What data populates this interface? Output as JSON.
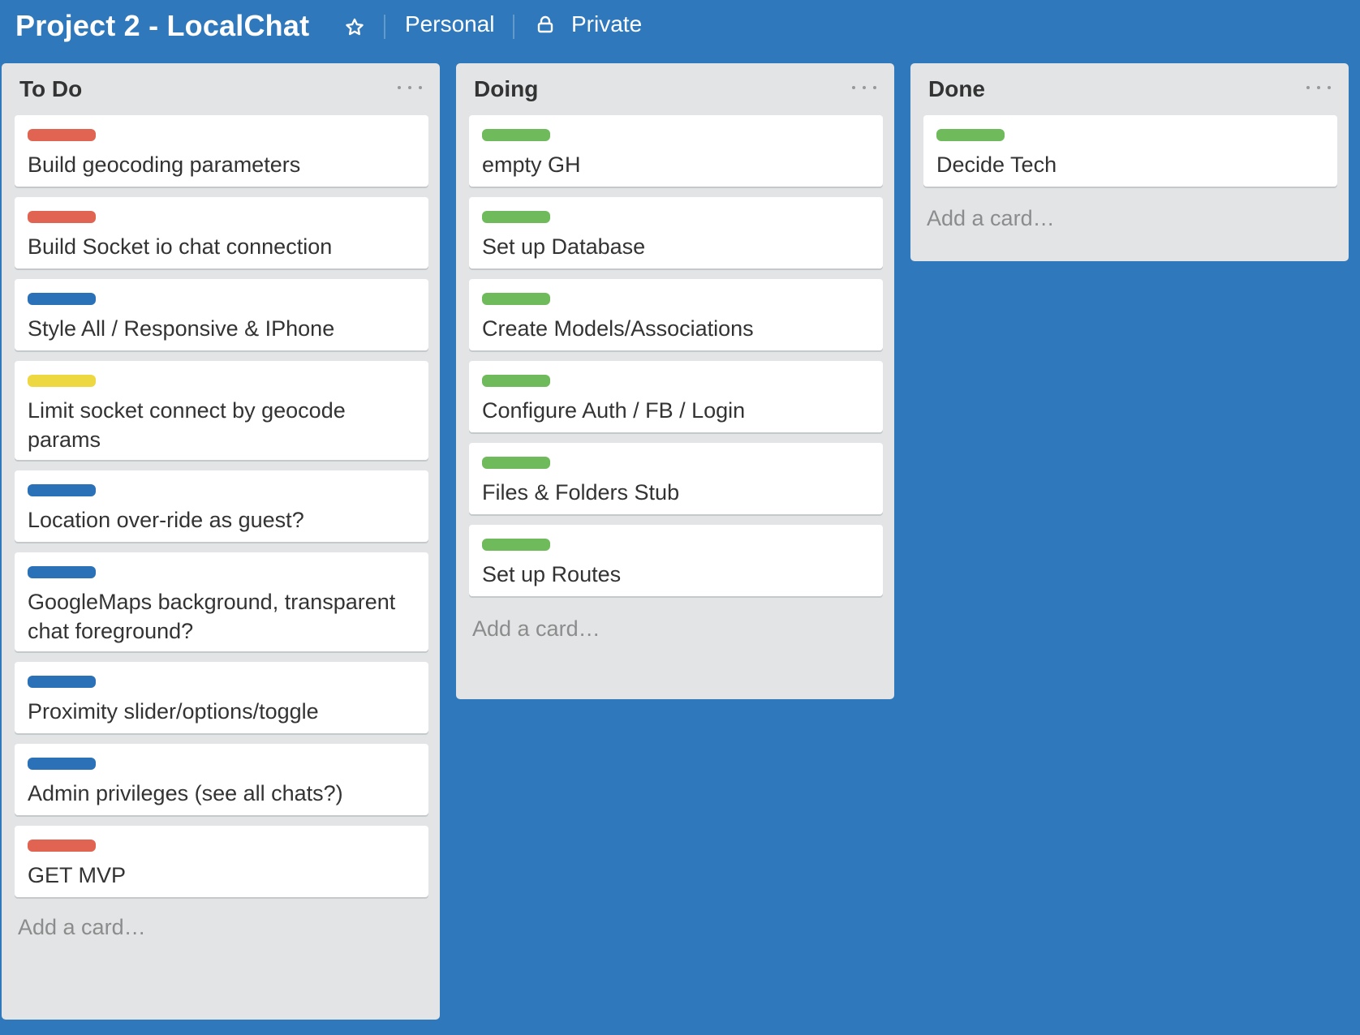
{
  "header": {
    "board_title": "Project 2 - LocalChat",
    "team": "Personal",
    "visibility": "Private",
    "star_icon": "star-icon",
    "lock_icon": "lock-icon"
  },
  "colors": {
    "background": "#2f78bb",
    "list_background": "#e2e4e6",
    "label_red": "#e06451",
    "label_blue": "#2a71b8",
    "label_yellow": "#eed842",
    "label_green": "#6fba5a"
  },
  "lists": [
    {
      "title": "To Do",
      "add_card": "Add a card…",
      "cards": [
        {
          "label": "red",
          "title": "Build geocoding parameters"
        },
        {
          "label": "red",
          "title": "Build Socket io chat connection"
        },
        {
          "label": "blue",
          "title": "Style All / Responsive & IPhone"
        },
        {
          "label": "yellow",
          "title": "Limit socket connect by geocode params"
        },
        {
          "label": "blue",
          "title": "Location over-ride as guest?"
        },
        {
          "label": "blue",
          "title": "GoogleMaps background, transparent chat foreground?"
        },
        {
          "label": "blue",
          "title": "Proximity slider/options/toggle"
        },
        {
          "label": "blue",
          "title": "Admin privileges (see all chats?)"
        },
        {
          "label": "red",
          "title": "GET MVP"
        }
      ]
    },
    {
      "title": "Doing",
      "add_card": "Add a card…",
      "cards": [
        {
          "label": "green",
          "title": "empty GH"
        },
        {
          "label": "green",
          "title": "Set up Database"
        },
        {
          "label": "green",
          "title": "Create Models/Associations"
        },
        {
          "label": "green",
          "title": "Configure Auth / FB / Login"
        },
        {
          "label": "green",
          "title": "Files & Folders Stub"
        },
        {
          "label": "green",
          "title": "Set up Routes"
        }
      ]
    },
    {
      "title": "Done",
      "add_card": "Add a card…",
      "cards": [
        {
          "label": "green",
          "title": "Decide Tech"
        }
      ]
    }
  ]
}
